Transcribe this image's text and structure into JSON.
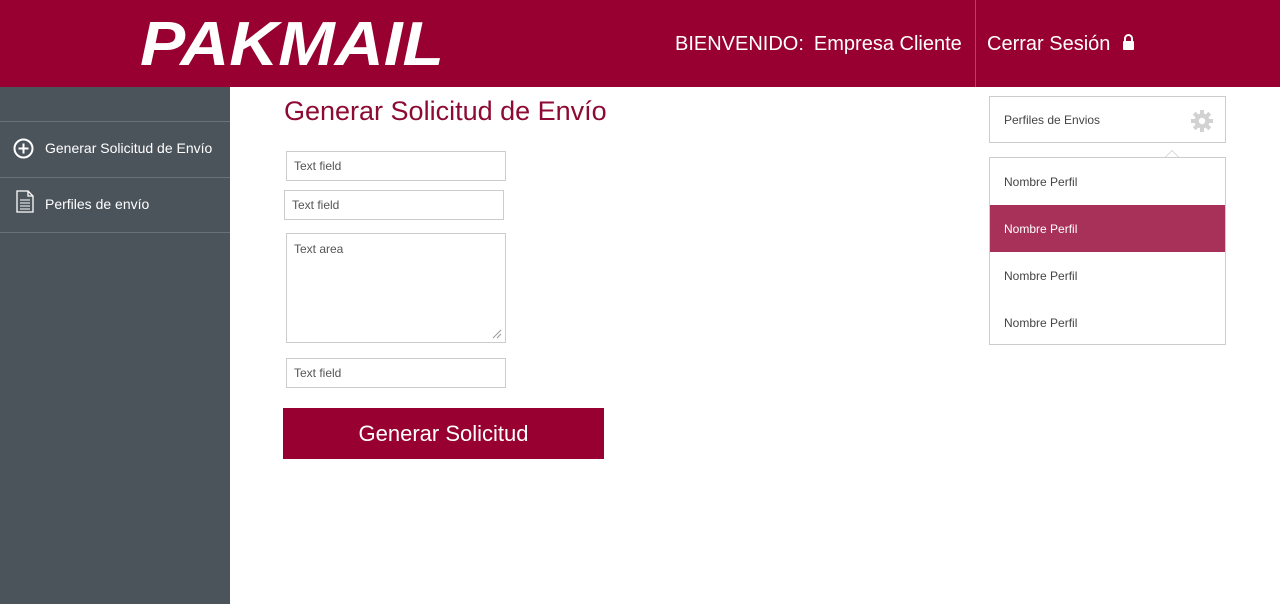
{
  "header": {
    "logo_text": "PAKMAIL",
    "welcome_label": "BIENVENIDO:",
    "user_name": "Empresa Cliente",
    "logout_label": "Cerrar Sesión"
  },
  "sidebar": {
    "items": [
      {
        "label": "Generar Solicitud de Envío",
        "icon": "plus-circle-icon"
      },
      {
        "label": "Perfiles de envío",
        "icon": "document-icon"
      }
    ]
  },
  "main": {
    "title": "Generar Solicitud de Envío",
    "fields": [
      {
        "placeholder": "Text field"
      },
      {
        "placeholder": "Text field"
      },
      {
        "placeholder": "Text area"
      },
      {
        "placeholder": "Text field"
      }
    ],
    "submit_label": "Generar Solicitud"
  },
  "profiles": {
    "button_label": "Perfiles de Envios",
    "icon": "gear-icon",
    "items": [
      {
        "label": "Nombre Perfil",
        "active": false
      },
      {
        "label": "Nombre Perfil",
        "active": true
      },
      {
        "label": "Nombre Perfil",
        "active": false
      },
      {
        "label": "Nombre Perfil",
        "active": false
      }
    ]
  },
  "colors": {
    "brand": "#970030",
    "sidebar": "#4b535b",
    "active_item": "#a8315a"
  }
}
